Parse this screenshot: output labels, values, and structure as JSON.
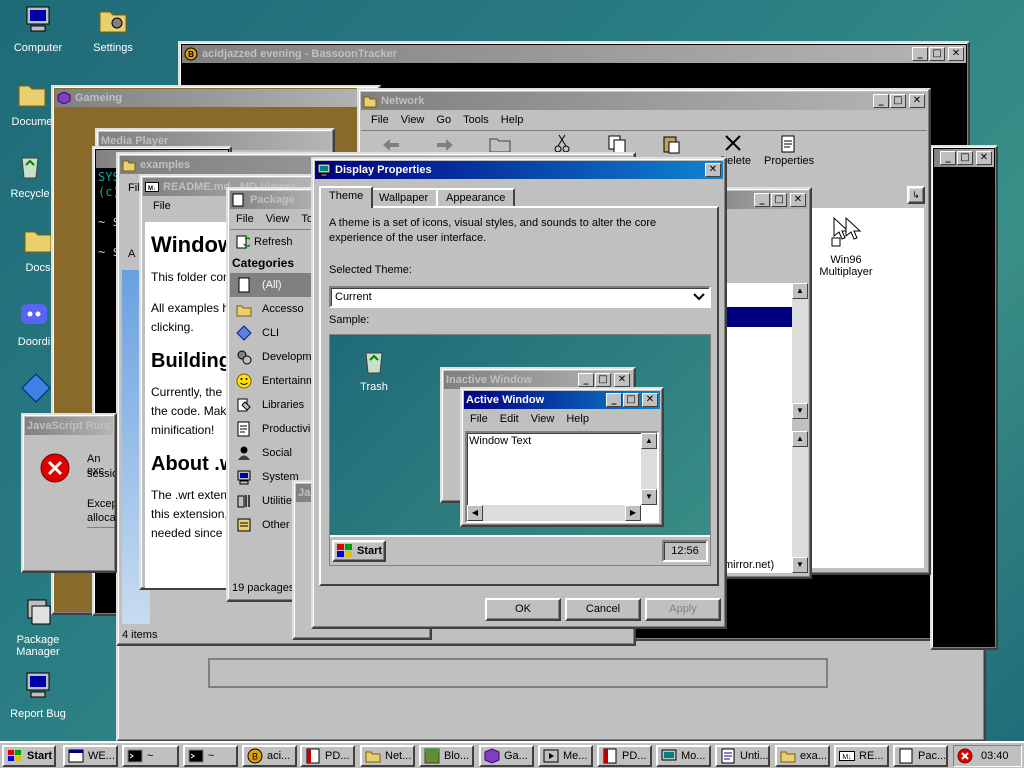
{
  "desktop": {
    "icons": [
      {
        "label": "Computer"
      },
      {
        "label": "Settings"
      },
      {
        "label": "Docume"
      },
      {
        "label": "Recycle"
      },
      {
        "label": "Docs"
      },
      {
        "label": "Doordi"
      },
      {
        "label": "Package Manager"
      },
      {
        "label": "Report Bug"
      }
    ]
  },
  "windows": {
    "bassoon": {
      "title": "acidjazzed evening - BassoonTracker"
    },
    "gameing": {
      "title": "Gameing"
    },
    "network": {
      "title": "Network",
      "menu": [
        "File",
        "View",
        "Go",
        "Tools",
        "Help"
      ],
      "toolbar": [
        "Delete",
        "Properties"
      ],
      "desktop_icon": "Win96 Multiplayer",
      "mirror_text": "mirror.net)"
    },
    "media": {
      "title": "Media Player"
    },
    "terminal": {
      "lines": [
        "SYS",
        "(c)",
        "~ $",
        "~ $"
      ]
    },
    "examples": {
      "title": "examples",
      "status": "4 items",
      "menu_fi": "Fil",
      "addr": "A"
    },
    "readme": {
      "title": "README.md - MD Viewer",
      "menu": "File",
      "h1": "Window",
      "p1": "This folder con",
      "p2a": "All examples h",
      "p2b": "clicking.",
      "h2a": "Building",
      "p3a": "Currently, the c",
      "p3b": "the code. Make",
      "p3c": "minification!",
      "h2b": "About .w",
      "p4a": "The .wrt extens",
      "p4b": "this extension,",
      "p4c": "needed since V"
    },
    "package": {
      "title": "Package",
      "menu": [
        "File",
        "View",
        "To"
      ],
      "refresh": "Refresh",
      "categories_label": "Categories",
      "categories": [
        "(All)",
        "Accesso",
        "CLI",
        "Developm",
        "Entertainm",
        "Libraries",
        "Productivi",
        "Social",
        "System",
        "Utilities",
        "Other"
      ],
      "status": "19 packages"
    },
    "jsrun": {
      "title": "JavaScript Runt",
      "msg1": "An exc",
      "msg2": "sessio",
      "msg3": "Excep",
      "msg4": "alloca"
    },
    "display": {
      "title": "Display Properties",
      "tabs": [
        "Theme",
        "Wallpaper",
        "Appearance"
      ],
      "description": "A theme is a set of icons, visual styles, and sounds to alter the core experience of the user interface.",
      "selected_label": "Selected Theme:",
      "selected_value": "Current",
      "sample_label": "Sample:",
      "sample": {
        "trash": "Trash",
        "inactive_title": "Inactive Window",
        "active_title": "Active Window",
        "active_menu": [
          "File",
          "Edit",
          "View",
          "Help"
        ],
        "window_text": "Window Text",
        "start": "Start",
        "clock": "12:56"
      },
      "ok": "OK",
      "cancel": "Cancel",
      "apply": "Apply"
    }
  },
  "taskbar": {
    "start": "Start",
    "items": [
      "WE...",
      "~",
      "~",
      "aci...",
      "PD...",
      "Net...",
      "Blo...",
      "Ga...",
      "Me...",
      "PD...",
      "Mo...",
      "Unti...",
      "exa...",
      "RE...",
      "Pac..."
    ],
    "clock": "03:40"
  },
  "colors": {
    "desktop": "#2a7d83",
    "active_title": "#000080",
    "inactive_title": "#808080",
    "face": "#c0c0c0"
  }
}
